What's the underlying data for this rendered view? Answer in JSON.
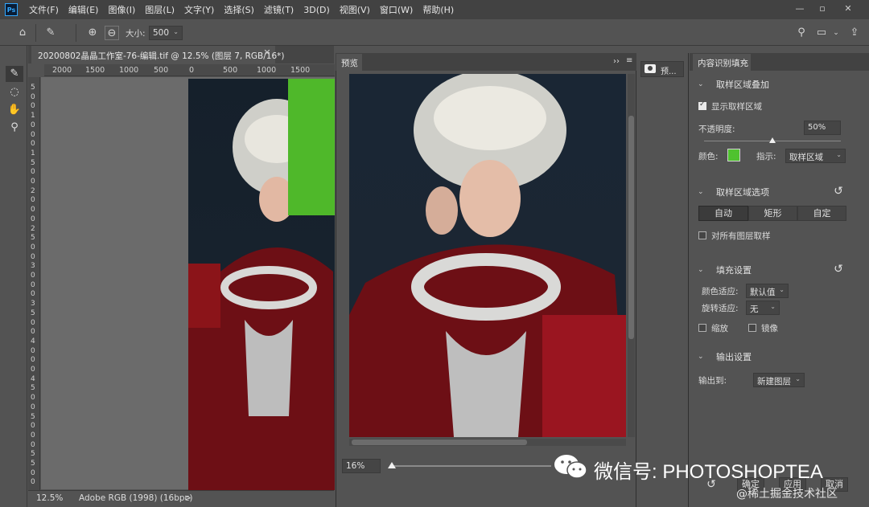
{
  "app": {
    "logo": "Ps"
  },
  "menu": [
    "文件(F)",
    "编辑(E)",
    "图像(I)",
    "图层(L)",
    "文字(Y)",
    "选择(S)",
    "滤镜(T)",
    "3D(D)",
    "视图(V)",
    "窗口(W)",
    "帮助(H)"
  ],
  "options": {
    "size_label": "大小:",
    "size_value": "500"
  },
  "document": {
    "tab_title": "20200802晶晶工作室-76-编辑.tif @ 12.5% (图层 7, RGB/16*)",
    "ruler_h": [
      "2000",
      "1500",
      "1000",
      "500",
      "0",
      "500",
      "1000",
      "1500"
    ],
    "ruler_v": [
      "5",
      "0",
      "0",
      "1",
      "0",
      "0",
      "0",
      "1",
      "5",
      "0",
      "0",
      "2",
      "0",
      "0",
      "0",
      "2",
      "5",
      "0",
      "0",
      "3",
      "0",
      "0",
      "0",
      "3",
      "5",
      "0",
      "0",
      "4",
      "0",
      "0",
      "0",
      "4",
      "5",
      "0",
      "0",
      "5",
      "0",
      "0",
      "0",
      "5",
      "5",
      "0",
      "0"
    ]
  },
  "status": {
    "zoom": "12.5%",
    "profile": "Adobe RGB (1998) (16bpc)",
    "arrow": ">"
  },
  "preview": {
    "tab": "预览",
    "zoom": "16%"
  },
  "side_panel": {
    "button_label": "预..."
  },
  "cafill": {
    "tab": "内容识别填充",
    "overlay": {
      "title": "取样区域叠加",
      "show_label": "显示取样区域",
      "show_checked": true,
      "opacity_label": "不透明度:",
      "opacity_value": "50%",
      "opacity_fraction": 0.5,
      "color_label": "颜色:",
      "color": "#4fc22f",
      "indicate_label": "指示:",
      "indicate_value": "取样区域"
    },
    "sampling": {
      "title": "取样区域选项",
      "options": [
        "自动",
        "矩形",
        "自定"
      ],
      "active": "自动",
      "all_layers_label": "对所有图层取样"
    },
    "fill": {
      "title": "填充设置",
      "color_adapt_label": "颜色适应:",
      "color_adapt_value": "默认值",
      "rotate_adapt_label": "旋转适应:",
      "rotate_adapt_value": "无",
      "scale_label": "缩放",
      "mirror_label": "镜像"
    },
    "output": {
      "title": "输出设置",
      "output_label": "输出到:",
      "output_value": "新建图层"
    },
    "buttons": {
      "ok": "确定",
      "apply": "应用",
      "cancel": "取消"
    }
  },
  "watermark": {
    "text": "微信号: PHOTOSHOPTEA",
    "secondary": "@稀土掘金技术社区"
  }
}
